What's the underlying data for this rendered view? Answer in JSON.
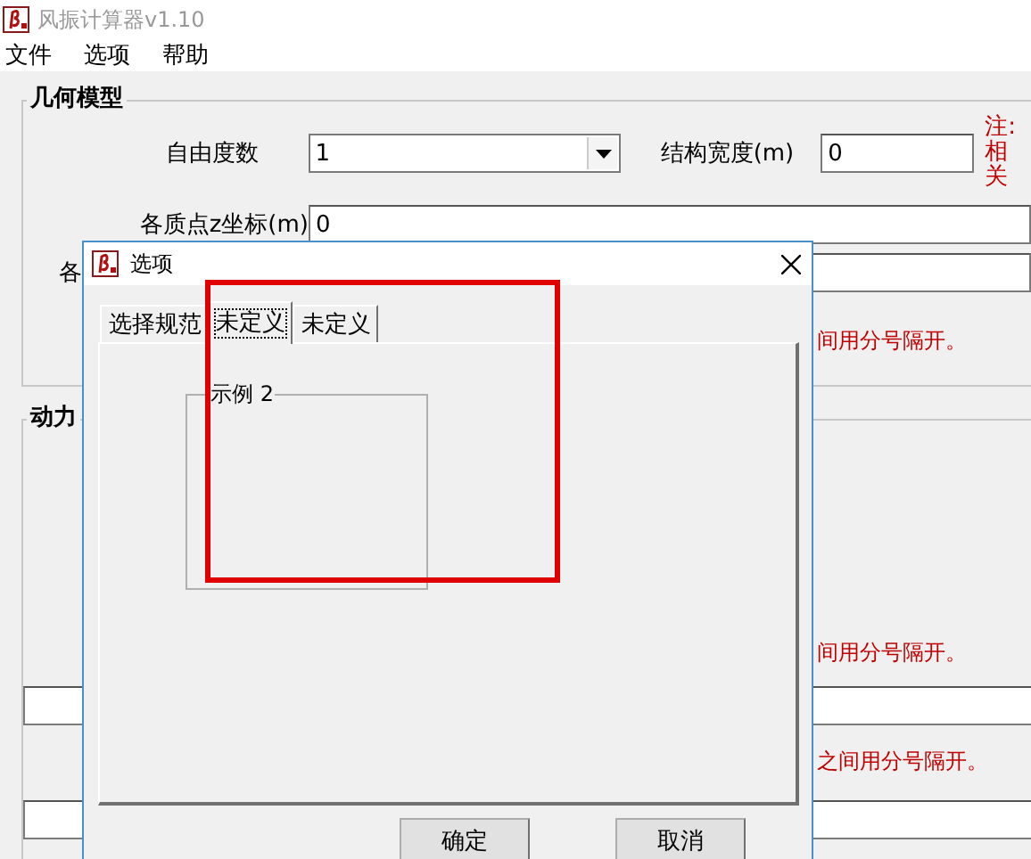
{
  "window": {
    "title": "风振计算器v1.10"
  },
  "menu": [
    {
      "label": "文件"
    },
    {
      "label": "选项"
    },
    {
      "label": "帮助"
    }
  ],
  "geometry_group": {
    "label": "几何模型",
    "dof_label": "自由度数",
    "dof_value": "1",
    "width_label": "结构宽度(m)",
    "width_value": "0",
    "note": [
      "注:",
      "相关"
    ],
    "z_label": "各质点z坐标(m)",
    "z_value": "0",
    "row3_label": "各",
    "hint": "间用分号隔开。"
  },
  "dynamics_group": {
    "label": "动力",
    "hints": [
      "间用分号隔开。",
      "之间用分号隔开。"
    ]
  },
  "dialog": {
    "title": "选项",
    "tabs": [
      {
        "label": "选择规范",
        "selected": false
      },
      {
        "label": "未定义",
        "selected": true
      },
      {
        "label": "未定义",
        "selected": false
      }
    ],
    "group_label": "示例 2",
    "buttons": [
      "确定",
      "取消"
    ]
  }
}
